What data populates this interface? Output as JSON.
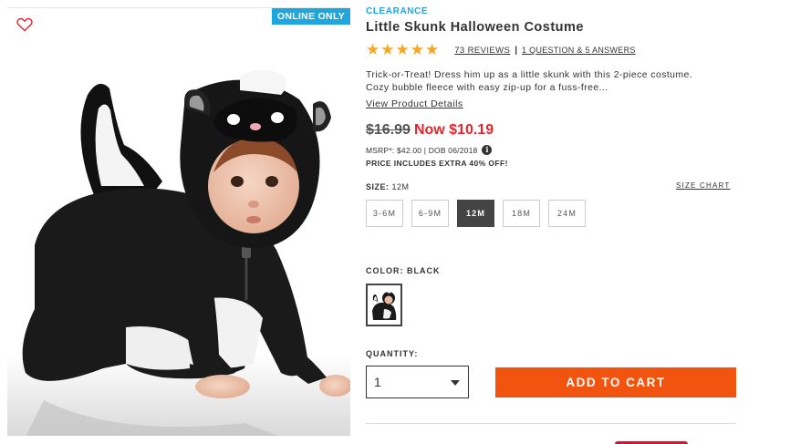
{
  "product": {
    "badge": "ONLINE ONLY",
    "category_tag": "CLEARANCE",
    "title": "Little Skunk Halloween Costume",
    "rating_stars": 5,
    "stars_text": "★★★★★",
    "reviews_text": "73 REVIEWS",
    "rating_separator": "|",
    "qa_text": "1 QUESTION & 5 ANSWERS",
    "description": "Trick-or-Treat! Dress him up as a little skunk with this 2-piece costume. Cozy bubble fleece with easy zip-up for a fuss-free...",
    "details_link": "View Product Details",
    "price_was": "$16.99",
    "price_now": "Now $10.19",
    "msrp_text": "MSRP*: $42.00 | DOB 06/2018",
    "info_icon": "i",
    "extra_off": "PRICE INCLUDES EXTRA 40% OFF!"
  },
  "size": {
    "label": "SIZE:",
    "selected_value": "12M",
    "chart_link": "SIZE CHART",
    "options": [
      "3-6M",
      "6-9M",
      "12M",
      "18M",
      "24M"
    ]
  },
  "color": {
    "label": "COLOR:",
    "selected_value": "BLACK"
  },
  "quantity": {
    "label": "QUANTITY:",
    "value": "1"
  },
  "cart": {
    "button_label": "ADD TO CART"
  },
  "icons": {
    "favorite": "heart-icon",
    "info": "info-icon",
    "dropdown": "chevron-down-icon"
  },
  "colors": {
    "badge": "#1fa6dc",
    "clearance": "#1fa6dc",
    "stars": "#f5a623",
    "sale_price": "#e0262e",
    "add_to_cart": "#f0540e",
    "favorite": "#e0262e"
  }
}
